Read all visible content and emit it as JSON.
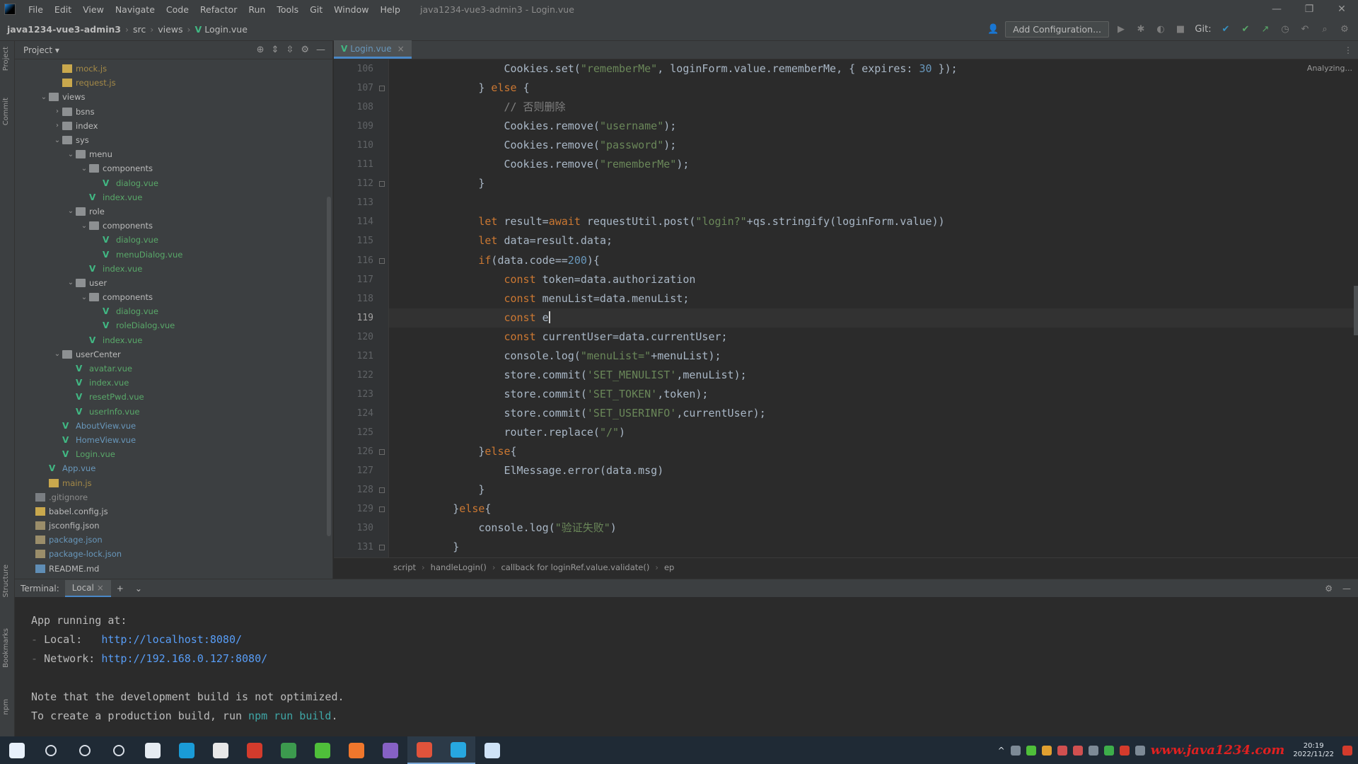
{
  "menubar": {
    "items": [
      "File",
      "Edit",
      "View",
      "Navigate",
      "Code",
      "Refactor",
      "Run",
      "Tools",
      "Git",
      "Window",
      "Help"
    ],
    "window_title": "java1234-vue3-admin3 - Login.vue",
    "controls": [
      "—",
      "❐",
      "✕"
    ]
  },
  "navbar": {
    "project": "java1234-vue3-admin3",
    "crumbs": [
      "src",
      "views"
    ],
    "file": "Login.vue",
    "add_configuration": "Add Configuration...",
    "git_label": "Git:"
  },
  "left_stripe": {
    "tabs": [
      "Project",
      "Commit"
    ],
    "bottom_tabs": [
      "Structure",
      "Bookmarks",
      "npm"
    ]
  },
  "project_panel": {
    "title": "Project",
    "tree": [
      {
        "indent": 3,
        "arrow": "",
        "icon": "js",
        "label": "mock.js",
        "color": "gold"
      },
      {
        "indent": 3,
        "arrow": "",
        "icon": "js",
        "label": "request.js",
        "color": "gold"
      },
      {
        "indent": 2,
        "arrow": "⌄",
        "icon": "folder",
        "label": "views",
        "color": "plain"
      },
      {
        "indent": 3,
        "arrow": "›",
        "icon": "folder",
        "label": "bsns",
        "color": "plain"
      },
      {
        "indent": 3,
        "arrow": "›",
        "icon": "folder",
        "label": "index",
        "color": "plain"
      },
      {
        "indent": 3,
        "arrow": "⌄",
        "icon": "folder",
        "label": "sys",
        "color": "plain"
      },
      {
        "indent": 4,
        "arrow": "⌄",
        "icon": "folder",
        "label": "menu",
        "color": "plain"
      },
      {
        "indent": 5,
        "arrow": "⌄",
        "icon": "folder",
        "label": "components",
        "color": "plain"
      },
      {
        "indent": 6,
        "arrow": "",
        "icon": "vue",
        "label": "dialog.vue",
        "color": "green"
      },
      {
        "indent": 5,
        "arrow": "",
        "icon": "vue",
        "label": "index.vue",
        "color": "green"
      },
      {
        "indent": 4,
        "arrow": "⌄",
        "icon": "folder",
        "label": "role",
        "color": "plain"
      },
      {
        "indent": 5,
        "arrow": "⌄",
        "icon": "folder",
        "label": "components",
        "color": "plain"
      },
      {
        "indent": 6,
        "arrow": "",
        "icon": "vue",
        "label": "dialog.vue",
        "color": "green"
      },
      {
        "indent": 6,
        "arrow": "",
        "icon": "vue",
        "label": "menuDialog.vue",
        "color": "green"
      },
      {
        "indent": 5,
        "arrow": "",
        "icon": "vue",
        "label": "index.vue",
        "color": "green"
      },
      {
        "indent": 4,
        "arrow": "⌄",
        "icon": "folder",
        "label": "user",
        "color": "plain"
      },
      {
        "indent": 5,
        "arrow": "⌄",
        "icon": "folder",
        "label": "components",
        "color": "plain"
      },
      {
        "indent": 6,
        "arrow": "",
        "icon": "vue",
        "label": "dialog.vue",
        "color": "green"
      },
      {
        "indent": 6,
        "arrow": "",
        "icon": "vue",
        "label": "roleDialog.vue",
        "color": "green"
      },
      {
        "indent": 5,
        "arrow": "",
        "icon": "vue",
        "label": "index.vue",
        "color": "green"
      },
      {
        "indent": 3,
        "arrow": "⌄",
        "icon": "folder",
        "label": "userCenter",
        "color": "plain"
      },
      {
        "indent": 4,
        "arrow": "",
        "icon": "vue",
        "label": "avatar.vue",
        "color": "green"
      },
      {
        "indent": 4,
        "arrow": "",
        "icon": "vue",
        "label": "index.vue",
        "color": "green"
      },
      {
        "indent": 4,
        "arrow": "",
        "icon": "vue",
        "label": "resetPwd.vue",
        "color": "green"
      },
      {
        "indent": 4,
        "arrow": "",
        "icon": "vue",
        "label": "userInfo.vue",
        "color": "green"
      },
      {
        "indent": 3,
        "arrow": "",
        "icon": "vue",
        "label": "AboutView.vue",
        "color": "vue"
      },
      {
        "indent": 3,
        "arrow": "",
        "icon": "vue",
        "label": "HomeView.vue",
        "color": "vue"
      },
      {
        "indent": 3,
        "arrow": "",
        "icon": "vue",
        "label": "Login.vue",
        "color": "green"
      },
      {
        "indent": 2,
        "arrow": "",
        "icon": "vue",
        "label": "App.vue",
        "color": "vue"
      },
      {
        "indent": 2,
        "arrow": "",
        "icon": "js",
        "label": "main.js",
        "color": "gold"
      },
      {
        "indent": 1,
        "arrow": "",
        "icon": "file",
        "label": ".gitignore",
        "color": "dim"
      },
      {
        "indent": 1,
        "arrow": "",
        "icon": "js",
        "label": "babel.config.js",
        "color": "plain"
      },
      {
        "indent": 1,
        "arrow": "",
        "icon": "json",
        "label": "jsconfig.json",
        "color": "plain"
      },
      {
        "indent": 1,
        "arrow": "",
        "icon": "json",
        "label": "package.json",
        "color": "vue"
      },
      {
        "indent": 1,
        "arrow": "",
        "icon": "json",
        "label": "package-lock.json",
        "color": "vue"
      },
      {
        "indent": 1,
        "arrow": "",
        "icon": "md",
        "label": "README.md",
        "color": "plain"
      }
    ]
  },
  "editor": {
    "tab": "Login.vue",
    "status": "Analyzing...",
    "current_line": 119,
    "lines": [
      {
        "n": 106,
        "indent": 8,
        "tokens": [
          [
            "",
            "Cookies.set("
          ],
          [
            "str",
            "\"rememberMe\""
          ],
          [
            "",
            ", loginForm.value.rememberMe, { expires: "
          ],
          [
            "num",
            "30"
          ],
          [
            "",
            " });"
          ]
        ]
      },
      {
        "n": 107,
        "indent": 6,
        "tokens": [
          [
            "",
            "} "
          ],
          [
            "kw",
            "else"
          ],
          [
            "",
            " {"
          ]
        ]
      },
      {
        "n": 108,
        "indent": 8,
        "tokens": [
          [
            "cmt",
            "// 否则删除"
          ]
        ]
      },
      {
        "n": 109,
        "indent": 8,
        "tokens": [
          [
            "",
            "Cookies.remove("
          ],
          [
            "str",
            "\"username\""
          ],
          [
            "",
            ");"
          ]
        ]
      },
      {
        "n": 110,
        "indent": 8,
        "tokens": [
          [
            "",
            "Cookies.remove("
          ],
          [
            "str",
            "\"password\""
          ],
          [
            "",
            ");"
          ]
        ]
      },
      {
        "n": 111,
        "indent": 8,
        "tokens": [
          [
            "",
            "Cookies.remove("
          ],
          [
            "str",
            "\"rememberMe\""
          ],
          [
            "",
            ");"
          ]
        ]
      },
      {
        "n": 112,
        "indent": 6,
        "tokens": [
          [
            "",
            "}"
          ]
        ]
      },
      {
        "n": 113,
        "indent": 0,
        "tokens": []
      },
      {
        "n": 114,
        "indent": 6,
        "tokens": [
          [
            "kw",
            "let"
          ],
          [
            "",
            " result="
          ],
          [
            "kw",
            "await"
          ],
          [
            "",
            " requestUtil.post("
          ],
          [
            "str",
            "\"login?\""
          ],
          [
            "",
            "+qs.stringify(loginForm.value))"
          ]
        ]
      },
      {
        "n": 115,
        "indent": 6,
        "tokens": [
          [
            "kw",
            "let"
          ],
          [
            "",
            " data=result.data;"
          ]
        ]
      },
      {
        "n": 116,
        "indent": 6,
        "tokens": [
          [
            "kw",
            "if"
          ],
          [
            "",
            "(data.code=="
          ],
          [
            "num",
            "200"
          ],
          [
            "",
            "){"
          ]
        ]
      },
      {
        "n": 117,
        "indent": 8,
        "tokens": [
          [
            "kw",
            "const"
          ],
          [
            "",
            " token=data.authorization"
          ]
        ]
      },
      {
        "n": 118,
        "indent": 8,
        "tokens": [
          [
            "kw",
            "const"
          ],
          [
            "",
            " menuList=data.menuList;"
          ]
        ]
      },
      {
        "n": 119,
        "indent": 8,
        "tokens": [
          [
            "kw",
            "const"
          ],
          [
            "",
            " e"
          ]
        ]
      },
      {
        "n": 120,
        "indent": 8,
        "tokens": [
          [
            "kw",
            "const"
          ],
          [
            "",
            " currentUser=data.currentUser;"
          ]
        ]
      },
      {
        "n": 121,
        "indent": 8,
        "tokens": [
          [
            "",
            "console.log("
          ],
          [
            "str",
            "\"menuList=\""
          ],
          [
            "",
            "+menuList);"
          ]
        ]
      },
      {
        "n": 122,
        "indent": 8,
        "tokens": [
          [
            "",
            "store.commit("
          ],
          [
            "str",
            "'SET_MENULIST'"
          ],
          [
            "",
            ",menuList);"
          ]
        ]
      },
      {
        "n": 123,
        "indent": 8,
        "tokens": [
          [
            "",
            "store.commit("
          ],
          [
            "str",
            "'SET_TOKEN'"
          ],
          [
            "",
            ",token);"
          ]
        ]
      },
      {
        "n": 124,
        "indent": 8,
        "tokens": [
          [
            "",
            "store.commit("
          ],
          [
            "str",
            "'SET_USERINFO'"
          ],
          [
            "",
            ",currentUser);"
          ]
        ]
      },
      {
        "n": 125,
        "indent": 8,
        "tokens": [
          [
            "",
            "router.replace("
          ],
          [
            "str",
            "\"/\""
          ],
          [
            "",
            ")"
          ]
        ]
      },
      {
        "n": 126,
        "indent": 6,
        "tokens": [
          [
            "",
            "}"
          ],
          [
            "kw",
            "else"
          ],
          [
            "",
            "{"
          ]
        ]
      },
      {
        "n": 127,
        "indent": 8,
        "tokens": [
          [
            "",
            "ElMessage.error(data.msg)"
          ]
        ]
      },
      {
        "n": 128,
        "indent": 6,
        "tokens": [
          [
            "",
            "}"
          ]
        ]
      },
      {
        "n": 129,
        "indent": 4,
        "tokens": [
          [
            "",
            "}"
          ],
          [
            "kw",
            "else"
          ],
          [
            "",
            "{"
          ]
        ]
      },
      {
        "n": 130,
        "indent": 6,
        "tokens": [
          [
            "",
            "console.log("
          ],
          [
            "str",
            "\"验证失败\""
          ],
          [
            "",
            ")"
          ]
        ]
      },
      {
        "n": 131,
        "indent": 4,
        "tokens": [
          [
            "",
            "}"
          ]
        ]
      }
    ],
    "folds": [
      107,
      112,
      116,
      126,
      128,
      129,
      131
    ]
  },
  "breadcrumbs": [
    "script",
    "handleLogin()",
    "callback for loginRef.value.validate()",
    "ep"
  ],
  "terminal": {
    "tabs": [
      "Terminal:",
      "Local"
    ],
    "lines": [
      [
        [
          "",
          "App running at:"
        ]
      ],
      [
        [
          "dash",
          "- "
        ],
        [
          "",
          "Local:   "
        ],
        [
          "link",
          "http://localhost:8080/"
        ]
      ],
      [
        [
          "dash",
          "- "
        ],
        [
          "",
          "Network: "
        ],
        [
          "link",
          "http://192.168.0.127:8080/"
        ]
      ],
      [
        [
          "",
          ""
        ]
      ],
      [
        [
          "",
          "Note that the development build is not optimized."
        ]
      ],
      [
        [
          "",
          "To create a production build, run "
        ],
        [
          "cmd",
          "npm run build"
        ],
        [
          "",
          "."
        ]
      ]
    ]
  },
  "taskbar": {
    "apps": [
      {
        "name": "start",
        "color": "#e8f1fb"
      },
      {
        "name": "search",
        "color": "#d8dee6"
      },
      {
        "name": "cortana",
        "color": "#d8dee6"
      },
      {
        "name": "task-view",
        "color": "#d8dee6"
      },
      {
        "name": "app-settings",
        "color": "#e6ecf2"
      },
      {
        "name": "edge",
        "color": "#1a9bd7"
      },
      {
        "name": "notepad",
        "color": "#e8e8e8"
      },
      {
        "name": "app-red",
        "color": "#d33b2c"
      },
      {
        "name": "chrome",
        "color": "#3c9a4e"
      },
      {
        "name": "wechat",
        "color": "#4fbf3a"
      },
      {
        "name": "firefox",
        "color": "#f0772c"
      },
      {
        "name": "vs",
        "color": "#8661c5"
      },
      {
        "name": "intellij",
        "color": "#e1533b"
      },
      {
        "name": "screen-tool",
        "color": "#27a7e0"
      },
      {
        "name": "app-chat",
        "color": "#cfe3f7"
      }
    ],
    "active": [
      "intellij",
      "screen-tool"
    ],
    "clock_time": "20:19",
    "clock_date": "2022/11/22",
    "watermark": "www.java1234.com"
  }
}
